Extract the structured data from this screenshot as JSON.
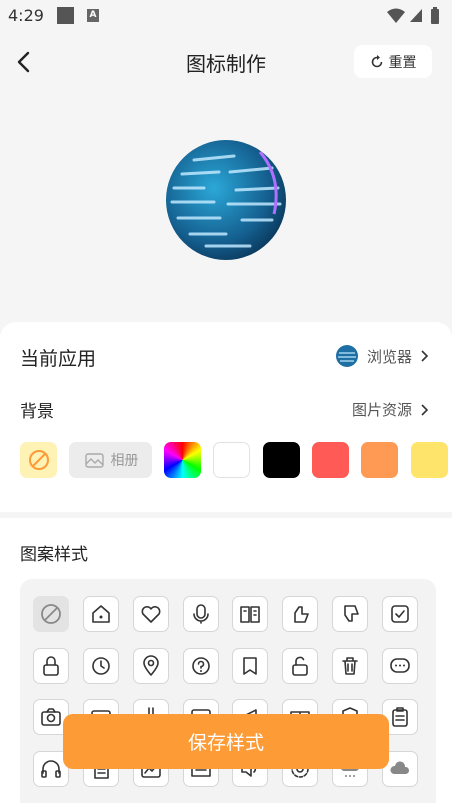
{
  "status_bar": {
    "time": "4:29",
    "a_badge": "A"
  },
  "header": {
    "title": "图标制作",
    "reset_label": "重置"
  },
  "current_app": {
    "label": "当前应用",
    "app_name": "浏览器"
  },
  "background": {
    "label": "背景",
    "source_link": "图片资源",
    "album_label": "相册",
    "colors": [
      "#ffffff",
      "#000000",
      "#ff5a55",
      "#ff9a55",
      "#ffe46b"
    ]
  },
  "pattern": {
    "title": "图案样式",
    "rows": [
      [
        "none-icon",
        "home-icon",
        "heart-icon",
        "mic-icon",
        "book-icon",
        "thumbs-up-icon",
        "thumbs-down-icon",
        "checkbox-icon"
      ],
      [
        "lock-icon",
        "clock-icon",
        "location-icon",
        "question-icon",
        "bookmark-icon",
        "unlock-icon",
        "trash-icon",
        "chat-icon"
      ],
      [
        "camera-icon",
        "card-icon",
        "flask-icon",
        "image-icon",
        "megaphone-icon",
        "gift-icon",
        "shield-icon",
        "clipboard-icon"
      ],
      [
        "headphones-icon",
        "document-icon",
        "chart-icon",
        "folder-icon",
        "speaker-icon",
        "settings-icon",
        "snow-cloud-icon",
        "cloud-icon"
      ]
    ]
  },
  "save_label": "保存样式",
  "colors": {
    "accent": "#fd9b36",
    "selected_bg": "#fff2b5"
  }
}
